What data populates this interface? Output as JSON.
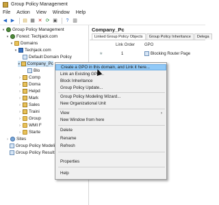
{
  "window": {
    "title": "Group Policy Management"
  },
  "menubar": [
    "File",
    "Action",
    "View",
    "Window",
    "Help"
  ],
  "toolbar": [
    "back",
    "forward",
    "up",
    "view",
    "delete",
    "refresh",
    "help",
    "properties"
  ],
  "tree": {
    "root": "Group Policy Management",
    "forest": "Forest: Techjack.com",
    "domains": "Domains",
    "domain": "Techjack.com",
    "default_policy": "Default Domain Policy",
    "company": "Company_Pc",
    "child_blo": "Blo",
    "children": [
      "Comp",
      "Doma",
      "Helpd",
      "Mark",
      "Sales",
      "Traini",
      "Group",
      "WMI F",
      "Starte"
    ],
    "sites": "Sites",
    "modeling": "Group Policy Modeling",
    "results": "Group Policy Results"
  },
  "right": {
    "header": "Company_Pc",
    "tabs": [
      "Linked Group Policy Objects",
      "Group Policy Inheritance",
      "Delega"
    ],
    "columns": [
      "Link Order",
      "GPO"
    ],
    "row": {
      "order": "1",
      "gpo": "Blocking Router Page"
    }
  },
  "context_menu": {
    "items": [
      "Create a GPO in this domain, and Link it here...",
      "Link an Existing GPO...",
      "Block Inheritance",
      "Group Policy Update...",
      "Group Policy Modeling Wizard...",
      "New Organizational Unit",
      "View",
      "New Window from here",
      "Delete",
      "Rename",
      "Refresh",
      "Properties",
      "Help"
    ],
    "highlighted": 0
  }
}
